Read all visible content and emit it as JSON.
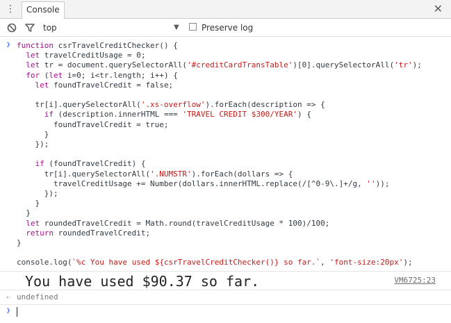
{
  "tabs": {
    "console": "Console"
  },
  "toolbar": {
    "context": "top",
    "preserve_log_label": "Preserve log"
  },
  "console": {
    "code_lines": [
      "function csrTravelCreditChecker() {",
      "  let travelCreditUsage = 0;",
      "  let tr = document.querySelectorAll('#creditCardTransTable')[0].querySelectorAll('tr');",
      "  for (let i=0; i<tr.length; i++) {",
      "    let foundTravelCredit = false;",
      "",
      "    tr[i].querySelectorAll('.xs-overflow').forEach(description => {",
      "      if (description.innerHTML === 'TRAVEL CREDIT $300/YEAR') {",
      "        foundTravelCredit = true;",
      "      }",
      "    });",
      "",
      "    if (foundTravelCredit) {",
      "      tr[i].querySelectorAll('.NUMSTR').forEach(dollars => {",
      "        travelCreditUsage += Number(dollars.innerHTML.replace(/[^0-9\\.]+/g, ''));",
      "      });",
      "    }",
      "  }",
      "  let roundedTravelCredit = Math.round(travelCreditUsage * 100)/100;",
      "  return roundedTravelCredit;",
      "}",
      "",
      "console.log(`%c You have used ${csrTravelCreditChecker()} so far.`, 'font-size:20px');"
    ],
    "log_output": "You have used $90.37 so far.",
    "source_link": "VM6725:23",
    "return_value": "undefined"
  },
  "colors": {
    "keyword": "#aa0d91",
    "string": "#c41a16",
    "prompt": "#367cf1"
  },
  "icons": [
    "kebab-menu-icon",
    "close-icon",
    "clear-console-icon",
    "filter-icon",
    "dropdown-arrow-icon",
    "prompt-chevron-icon",
    "return-arrow-icon"
  ]
}
